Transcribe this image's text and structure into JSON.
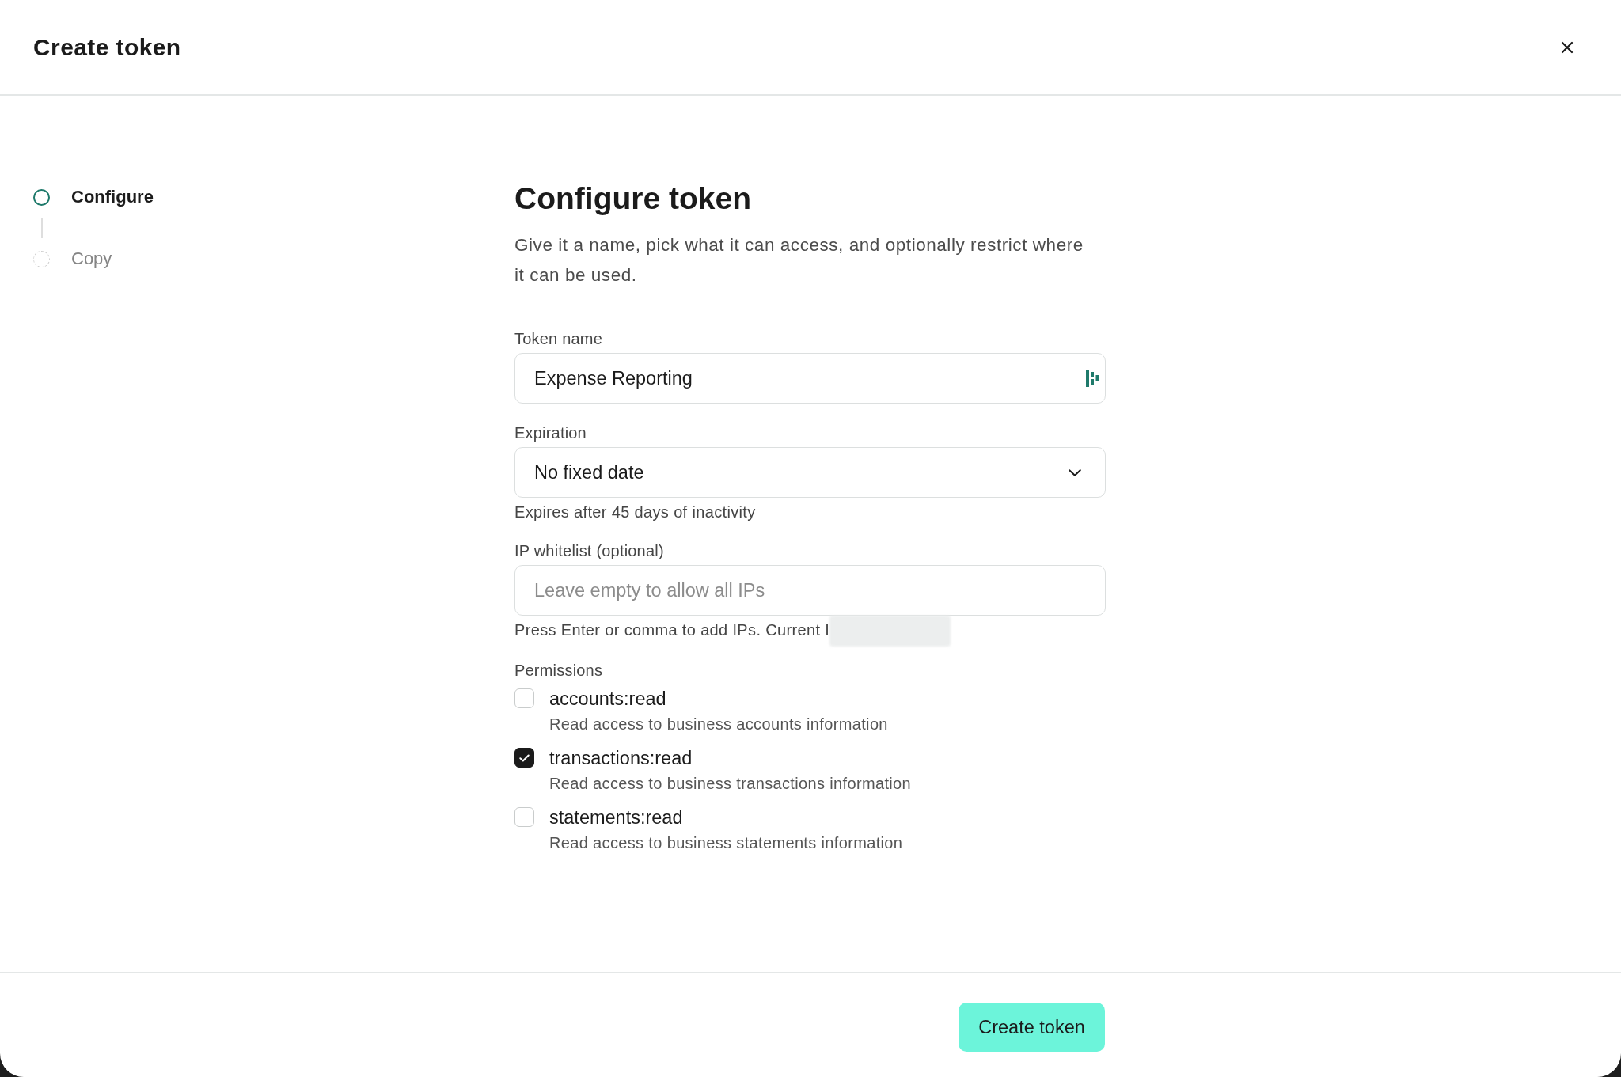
{
  "dialog": {
    "title": "Create token"
  },
  "steps": [
    {
      "label": "Configure",
      "selected": true
    },
    {
      "label": "Copy",
      "selected": false
    }
  ],
  "form": {
    "heading": "Configure token",
    "description": "Give it a name, pick what it can access, and optionally restrict where it can be used.",
    "fields": [
      {
        "kind": "text",
        "label": "Token name",
        "value": "Expense Reporting",
        "autofill_icon": true
      },
      {
        "kind": "select",
        "label": "Expiration",
        "value": "No fixed date",
        "helper": "Expires after 45 days of inactivity",
        "helper_redacted": false
      },
      {
        "kind": "text",
        "label": "IP whitelist (optional)",
        "placeholder": "Leave empty to allow all IPs",
        "autofill_icon": false,
        "helper": "Press Enter or comma to add IPs. Current I",
        "helper_redacted": true
      }
    ],
    "permissions": {
      "label": "Permissions",
      "items": [
        {
          "name": "accounts:read",
          "description": "Read access to business accounts information",
          "checked": false
        },
        {
          "name": "transactions:read",
          "description": "Read access to business transactions information",
          "checked": true
        },
        {
          "name": "statements:read",
          "description": "Read access to business statements information",
          "checked": false
        }
      ]
    }
  },
  "footer": {
    "button": "Create token"
  }
}
